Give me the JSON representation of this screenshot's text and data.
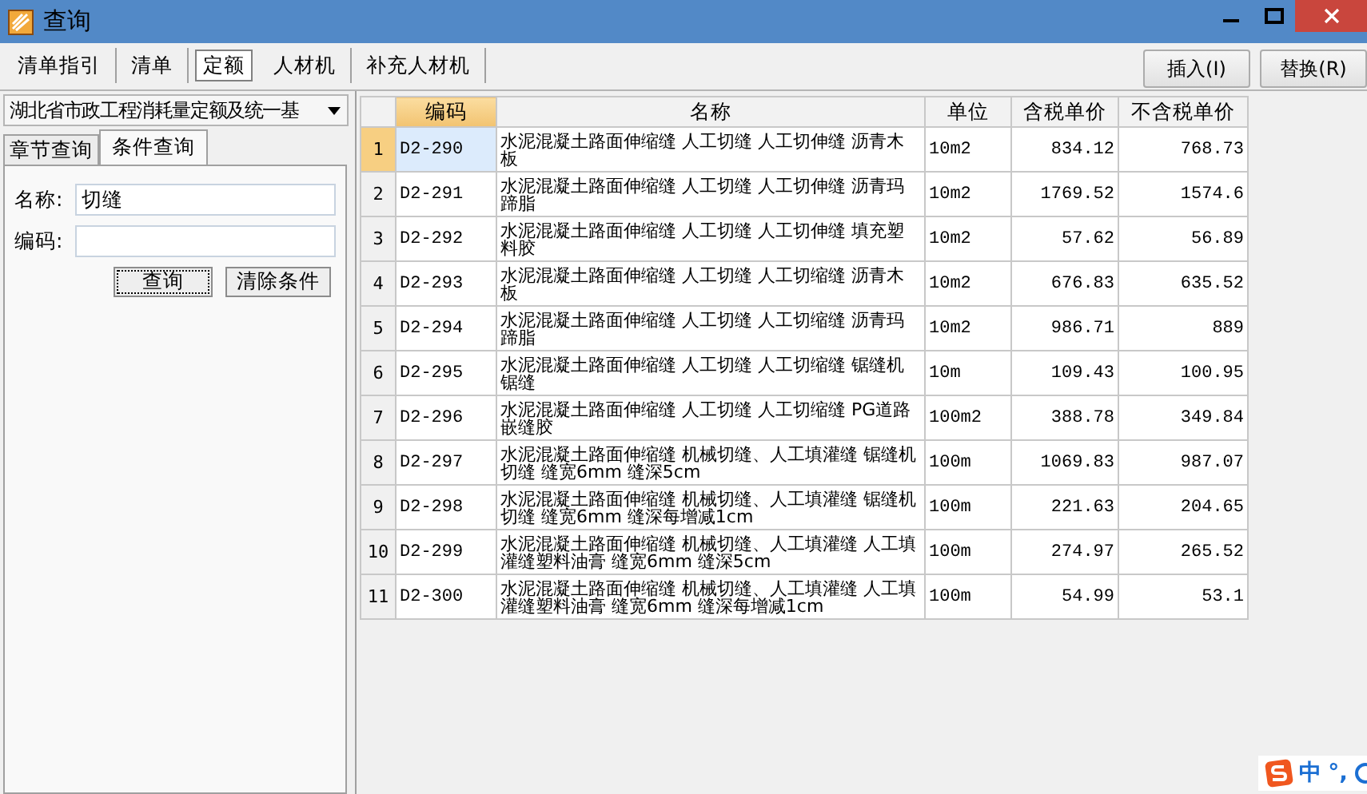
{
  "window": {
    "title": "查询"
  },
  "tabs": [
    {
      "label": "清单指引",
      "selected": false
    },
    {
      "label": "清单",
      "selected": false
    },
    {
      "label": "定额",
      "selected": true
    },
    {
      "label": "人材机",
      "selected": false
    },
    {
      "label": "补充人材机",
      "selected": false
    }
  ],
  "buttons": [
    "插入(I)",
    "替换(R)"
  ],
  "library_select": {
    "value": "湖北省市政工程消耗量定额及统一基"
  },
  "search_tabs": [
    {
      "label": "章节查询",
      "selected": false
    },
    {
      "label": "条件查询",
      "selected": true
    }
  ],
  "form": {
    "fields": [
      {
        "label": "名称:",
        "value": "切缝"
      },
      {
        "label": "编码:"
      }
    ],
    "buttons": [
      "查询",
      "清除条件"
    ]
  },
  "table": {
    "columns": [
      "编码",
      "名称",
      "单位",
      "含税单价",
      "不含税单价"
    ],
    "rows": [
      {
        "index": "1",
        "selected": true,
        "cells": [
          "D2-290",
          "水泥混凝土路面伸缩缝 人工切缝 人工切伸缝 沥青木板",
          "10m2",
          "834.12",
          "768.73"
        ]
      },
      {
        "index": "2",
        "selected": false,
        "cells": [
          "D2-291",
          "水泥混凝土路面伸缩缝 人工切缝 人工切伸缝 沥青玛蹄脂",
          "10m2",
          "1769.52",
          "1574.6"
        ]
      },
      {
        "index": "3",
        "selected": false,
        "cells": [
          "D2-292",
          "水泥混凝土路面伸缩缝 人工切缝 人工切伸缝 填充塑料胶",
          "10m2",
          "57.62",
          "56.89"
        ]
      },
      {
        "index": "4",
        "selected": false,
        "cells": [
          "D2-293",
          "水泥混凝土路面伸缩缝 人工切缝 人工切缩缝 沥青木板",
          "10m2",
          "676.83",
          "635.52"
        ]
      },
      {
        "index": "5",
        "selected": false,
        "cells": [
          "D2-294",
          "水泥混凝土路面伸缩缝 人工切缝 人工切缩缝 沥青玛蹄脂",
          "10m2",
          "986.71",
          "889"
        ]
      },
      {
        "index": "6",
        "selected": false,
        "cells": [
          "D2-295",
          "水泥混凝土路面伸缩缝 人工切缝 人工切缩缝 锯缝机锯缝",
          "10m",
          "109.43",
          "100.95"
        ]
      },
      {
        "index": "7",
        "selected": false,
        "cells": [
          "D2-296",
          "水泥混凝土路面伸缩缝 人工切缝 人工切缩缝  PG道路嵌缝胶",
          "100m2",
          "388.78",
          "349.84"
        ]
      },
      {
        "index": "8",
        "selected": false,
        "cells": [
          "D2-297",
          "水泥混凝土路面伸缩缝 机械切缝、人工填灌缝 锯缝机切缝 缝宽6mm 缝深5cm",
          "100m",
          "1069.83",
          "987.07"
        ]
      },
      {
        "index": "9",
        "selected": false,
        "cells": [
          "D2-298",
          "水泥混凝土路面伸缩缝 机械切缝、人工填灌缝 锯缝机切缝 缝宽6mm 缝深每增减1cm",
          "100m",
          "221.63",
          "204.65"
        ]
      },
      {
        "index": "10",
        "selected": false,
        "cells": [
          "D2-299",
          "水泥混凝土路面伸缩缝 机械切缝、人工填灌缝 人工填灌缝塑料油膏 缝宽6mm 缝深5cm",
          "100m",
          "274.97",
          "265.52"
        ]
      },
      {
        "index": "11",
        "selected": false,
        "cells": [
          "D2-300",
          "水泥混凝土路面伸缩缝 机械切缝、人工填灌缝 人工填灌缝塑料油膏 缝宽6mm 缝深每增减1cm",
          "100m",
          "54.99",
          "53.1"
        ]
      }
    ]
  },
  "ime_bar": {
    "items": [
      "中",
      "°,"
    ]
  }
}
